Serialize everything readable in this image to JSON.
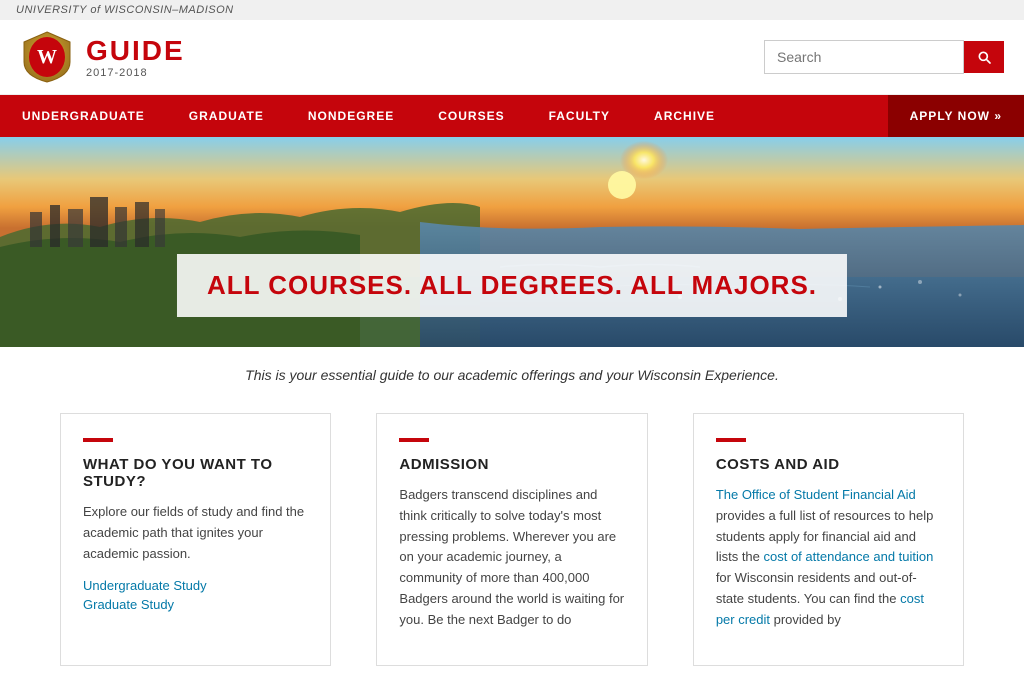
{
  "topbar": {
    "text": "UNIVERSITY of WISCONSIN–MADISON"
  },
  "header": {
    "guide_title": "GUIDE",
    "guide_subtitle": "2017-2018",
    "search_placeholder": "Search"
  },
  "nav": {
    "items": [
      {
        "label": "UNDERGRADUATE",
        "id": "undergraduate"
      },
      {
        "label": "GRADUATE",
        "id": "graduate"
      },
      {
        "label": "NONDEGREE",
        "id": "nondegree"
      },
      {
        "label": "COURSES",
        "id": "courses"
      },
      {
        "label": "FACULTY",
        "id": "faculty"
      },
      {
        "label": "ARCHIVE",
        "id": "archive"
      },
      {
        "label": "APPLY NOW »",
        "id": "apply-now",
        "special": true
      }
    ]
  },
  "hero": {
    "banner_text": "ALL COURSES. ALL DEGREES. ALL MAJORS."
  },
  "tagline": {
    "text": "This is your essential guide to our academic offerings and your Wisconsin Experience."
  },
  "cards": [
    {
      "id": "study",
      "title": "WHAT DO YOU WANT TO STUDY?",
      "body": "Explore our fields of study and find the academic path that ignites your academic passion.",
      "links": [
        {
          "label": "Undergraduate Study",
          "id": "undergrad-study-link"
        },
        {
          "label": "Graduate Study",
          "id": "grad-study-link"
        }
      ]
    },
    {
      "id": "admission",
      "title": "ADMISSION",
      "body": "Badgers transcend disciplines and think critically to solve today's most pressing problems. Wherever you are on your academic journey, a community of more than 400,000 Badgers around the world is waiting for you. Be the next Badger to do",
      "links": []
    },
    {
      "id": "costs",
      "title": "COSTS AND AID",
      "link1_label": "The Office of Student Financial Aid",
      "body1": " provides a full list of resources to help students apply for financial aid and lists the ",
      "link2_label": "cost of attendance and tuition",
      "body2": " for Wisconsin residents and out-of-state students. You can find the ",
      "link3_label": "cost per credit",
      "body3": " provided by",
      "links": []
    }
  ],
  "colors": {
    "red": "#c5050c",
    "dark_red": "#8b0000",
    "link_blue": "#0479a8"
  }
}
